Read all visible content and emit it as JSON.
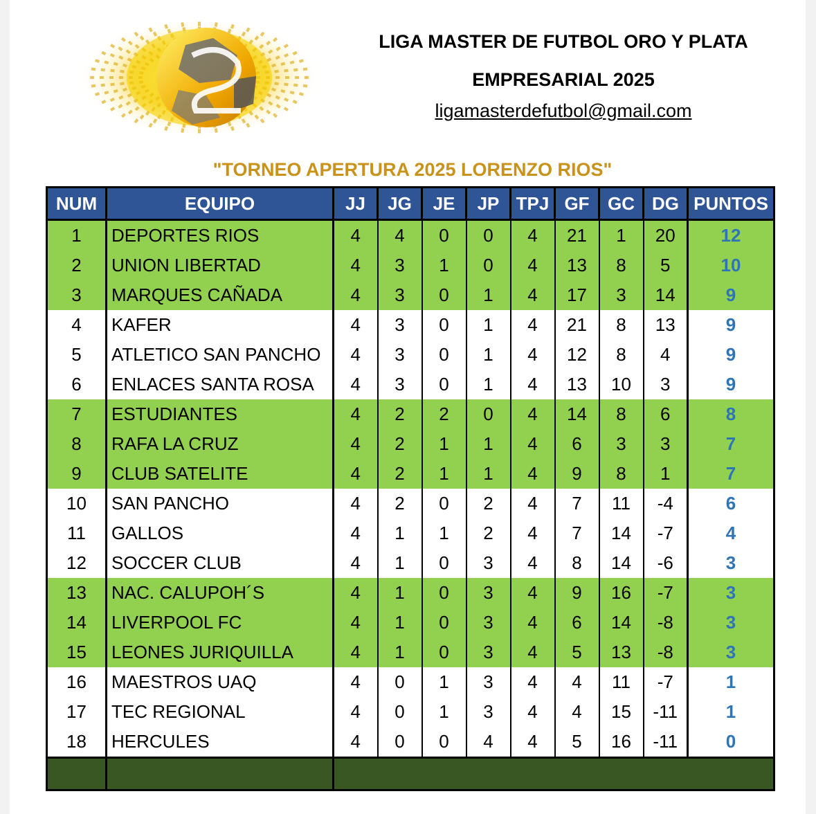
{
  "header": {
    "title_line1": "LIGA MASTER DE FUTBOL ORO Y PLATA",
    "title_line2": "EMPRESARIAL 2025",
    "email": "ligamasterdefutbol@gmail.com",
    "logo_icon": "soccer-ball-logo-icon"
  },
  "tournament": "\"TORNEO APERTURA 2025 LORENZO RIOS\"",
  "colors": {
    "header_bg": "#2f5597",
    "highlight_row": "#92d050",
    "points_text": "#2e75b6",
    "tournament_text": "#c9921a",
    "footer_bg": "#385723"
  },
  "table": {
    "columns": [
      "NUM",
      "EQUIPO",
      "JJ",
      "JG",
      "JE",
      "JP",
      "TPJ",
      "GF",
      "GC",
      "DG",
      "PUNTOS"
    ],
    "rows": [
      {
        "num": "1",
        "team": "DEPORTES RIOS",
        "jj": "4",
        "jg": "4",
        "je": "0",
        "jp": "0",
        "tpj": "4",
        "gf": "21",
        "gc": "1",
        "dg": "20",
        "pts": "12",
        "hl": true
      },
      {
        "num": "2",
        "team": "UNION LIBERTAD",
        "jj": "4",
        "jg": "3",
        "je": "1",
        "jp": "0",
        "tpj": "4",
        "gf": "13",
        "gc": "8",
        "dg": "5",
        "pts": "10",
        "hl": true
      },
      {
        "num": "3",
        "team": "MARQUES CAÑADA",
        "jj": "4",
        "jg": "3",
        "je": "0",
        "jp": "1",
        "tpj": "4",
        "gf": "17",
        "gc": "3",
        "dg": "14",
        "pts": "9",
        "hl": true
      },
      {
        "num": "4",
        "team": "KAFER",
        "jj": "4",
        "jg": "3",
        "je": "0",
        "jp": "1",
        "tpj": "4",
        "gf": "21",
        "gc": "8",
        "dg": "13",
        "pts": "9",
        "hl": false
      },
      {
        "num": "5",
        "team": "ATLETICO SAN PANCHO",
        "jj": "4",
        "jg": "3",
        "je": "0",
        "jp": "1",
        "tpj": "4",
        "gf": "12",
        "gc": "8",
        "dg": "4",
        "pts": "9",
        "hl": false
      },
      {
        "num": "6",
        "team": "ENLACES SANTA ROSA",
        "jj": "4",
        "jg": "3",
        "je": "0",
        "jp": "1",
        "tpj": "4",
        "gf": "13",
        "gc": "10",
        "dg": "3",
        "pts": "9",
        "hl": false
      },
      {
        "num": "7",
        "team": "ESTUDIANTES",
        "jj": "4",
        "jg": "2",
        "je": "2",
        "jp": "0",
        "tpj": "4",
        "gf": "14",
        "gc": "8",
        "dg": "6",
        "pts": "8",
        "hl": true
      },
      {
        "num": "8",
        "team": "RAFA LA CRUZ",
        "jj": "4",
        "jg": "2",
        "je": "1",
        "jp": "1",
        "tpj": "4",
        "gf": "6",
        "gc": "3",
        "dg": "3",
        "pts": "7",
        "hl": true
      },
      {
        "num": "9",
        "team": "CLUB SATELITE",
        "jj": "4",
        "jg": "2",
        "je": "1",
        "jp": "1",
        "tpj": "4",
        "gf": "9",
        "gc": "8",
        "dg": "1",
        "pts": "7",
        "hl": true
      },
      {
        "num": "10",
        "team": "SAN PANCHO",
        "jj": "4",
        "jg": "2",
        "je": "0",
        "jp": "2",
        "tpj": "4",
        "gf": "7",
        "gc": "11",
        "dg": "-4",
        "pts": "6",
        "hl": false
      },
      {
        "num": "11",
        "team": "GALLOS",
        "jj": "4",
        "jg": "1",
        "je": "1",
        "jp": "2",
        "tpj": "4",
        "gf": "7",
        "gc": "14",
        "dg": "-7",
        "pts": "4",
        "hl": false
      },
      {
        "num": "12",
        "team": "SOCCER CLUB",
        "jj": "4",
        "jg": "1",
        "je": "0",
        "jp": "3",
        "tpj": "4",
        "gf": "8",
        "gc": "14",
        "dg": "-6",
        "pts": "3",
        "hl": false
      },
      {
        "num": "13",
        "team": "NAC. CALUPOH´S",
        "jj": "4",
        "jg": "1",
        "je": "0",
        "jp": "3",
        "tpj": "4",
        "gf": "9",
        "gc": "16",
        "dg": "-7",
        "pts": "3",
        "hl": true
      },
      {
        "num": "14",
        "team": "LIVERPOOL FC",
        "jj": "4",
        "jg": "1",
        "je": "0",
        "jp": "3",
        "tpj": "4",
        "gf": "6",
        "gc": "14",
        "dg": "-8",
        "pts": "3",
        "hl": true
      },
      {
        "num": "15",
        "team": "LEONES JURIQUILLA",
        "jj": "4",
        "jg": "1",
        "je": "0",
        "jp": "3",
        "tpj": "4",
        "gf": "5",
        "gc": "13",
        "dg": "-8",
        "pts": "3",
        "hl": true
      },
      {
        "num": "16",
        "team": "MAESTROS UAQ",
        "jj": "4",
        "jg": "0",
        "je": "1",
        "jp": "3",
        "tpj": "4",
        "gf": "4",
        "gc": "11",
        "dg": "-7",
        "pts": "1",
        "hl": false
      },
      {
        "num": "17",
        "team": "TEC REGIONAL",
        "jj": "4",
        "jg": "0",
        "je": "1",
        "jp": "3",
        "tpj": "4",
        "gf": "4",
        "gc": "15",
        "dg": "-11",
        "pts": "1",
        "hl": false
      },
      {
        "num": "18",
        "team": "HERCULES",
        "jj": "4",
        "jg": "0",
        "je": "0",
        "jp": "4",
        "tpj": "4",
        "gf": "5",
        "gc": "16",
        "dg": "-11",
        "pts": "0",
        "hl": false
      }
    ]
  }
}
